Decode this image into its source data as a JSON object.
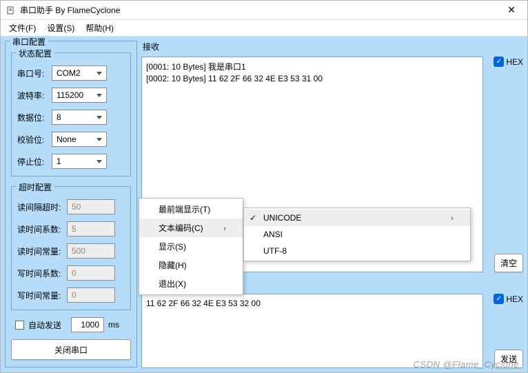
{
  "window": {
    "title": "串口助手 By FlameCyclone"
  },
  "menubar": {
    "file": "文件(F)",
    "settings": "设置(S)",
    "help": "帮助(H)"
  },
  "groups": {
    "serial": "串口配置",
    "state": "状态配置",
    "timeout": "超时配置"
  },
  "labels": {
    "port": "串口号:",
    "baud": "波特率:",
    "databits": "数据位:",
    "parity": "校验位:",
    "stopbits": "停止位:",
    "readInterval": "读间隔超时:",
    "readMult": "读时间系数:",
    "readConst": "读时间常量:",
    "writeMult": "写时间系数:",
    "writeConst": "写时间常量:",
    "autosend": "自动发送",
    "ms": "ms",
    "recv": "接收",
    "send": "发送",
    "hex": "HEX",
    "clear": "清空",
    "sendBtn": "发送",
    "closePort": "关闭串口"
  },
  "values": {
    "port": "COM2",
    "baud": "115200",
    "databits": "8",
    "parity": "None",
    "stopbits": "1",
    "readInterval": "50",
    "readMult": "5",
    "readConst": "500",
    "writeMult": "0",
    "writeConst": "0",
    "autosendInterval": "1000"
  },
  "recvText": "[0001: 10 Bytes] 我是串口1\n[0002: 10 Bytes] 11 62 2F 66 32 4E E3 53 31 00",
  "sendText": "11 62 2F 66 32 4E E3 53 32 00",
  "contextMenu": {
    "topmost": "最前端显示(T)",
    "encoding": "文本编码(C)",
    "show": "显示(S)",
    "hide": "隐藏(H)",
    "exit": "退出(X)"
  },
  "encodingSubmenu": {
    "unicode": "UNICODE",
    "ansi": "ANSI",
    "utf8": "UTF-8"
  },
  "watermark": "CSDN @Flame_Cyclone"
}
